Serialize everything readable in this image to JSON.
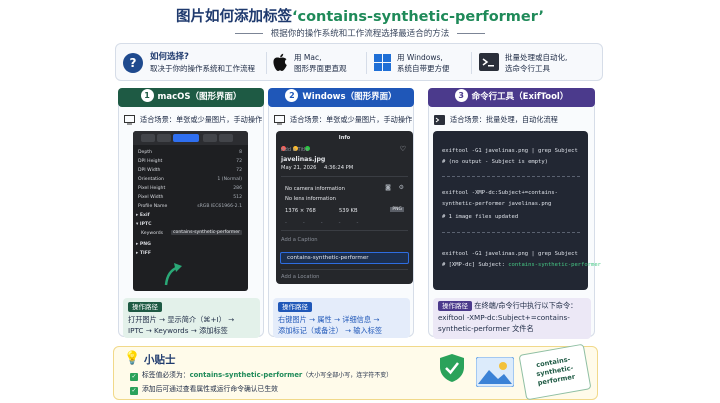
{
  "header": {
    "title_prefix": "图片如何添加标签",
    "title_keyword": "‘contains-synthetic-performer’",
    "subtitle": "根据你的操作系统和工作流程选择最适合的方法"
  },
  "guide": {
    "q_icon": "?",
    "heading": "如何选择?",
    "desc": "取决于你的操作系统和工作流程",
    "items": [
      {
        "icon": "apple-icon",
        "line1": "用 Mac,",
        "line2": "图形界面更直观"
      },
      {
        "icon": "windows-icon",
        "line1": "用 Windows,",
        "line2": "系统自带更方便"
      },
      {
        "icon": "terminal-icon",
        "line1": "批量处理或自动化,",
        "line2": "选命令行工具"
      }
    ]
  },
  "methods": [
    {
      "num": "1",
      "title": "macOS（图形界面）",
      "color": "#1e5a44",
      "scene": "适合场景：单张或少量图片，手动操作",
      "path_tag": "操作路径",
      "path_line1": "打开图片 → 显示简介（⌘+I） →",
      "path_line2": "IPTC → Keywords → 添加标签"
    },
    {
      "num": "2",
      "title": "Windows（图形界面）",
      "color": "#1f57b8",
      "scene": "适合场景：单张或少量图片，手动操作",
      "path_tag": "操作路径",
      "path_line1": "右键图片 → 属性 → 详细信息 →",
      "path_line2": "添加标记（或备注） → 输入标签"
    },
    {
      "num": "3",
      "title": "命令行工具（ExifTool）",
      "color": "#4b3a8c",
      "scene": "适合场景：批量处理，自动化流程",
      "path_tag": "操作路径",
      "path_line1": "在终端/命令行中执行以下命令：",
      "path_line2": "exiftool -XMP-dc:Subject+=contains-",
      "path_line3": "synthetic-performer 文件名"
    }
  ],
  "mac_panel": {
    "rows": [
      {
        "k": "Depth",
        "v": "8"
      },
      {
        "k": "DPI Height",
        "v": "72"
      },
      {
        "k": "DPI Width",
        "v": "72"
      },
      {
        "k": "Orientation",
        "v": "1 (Normal)"
      },
      {
        "k": "Pixel Height",
        "v": "286"
      },
      {
        "k": "Pixel Width",
        "v": "512"
      },
      {
        "k": "Profile Name",
        "v": "sRGB IEC61966-2.1"
      }
    ],
    "sec_exif": "▸ Exif",
    "sec_iptc": "▾ IPTC",
    "keywords_label": "Keywords",
    "keywords_value": "contains-synthetic-performer",
    "sec_png": "▸ PNG",
    "sec_tiff": "▸ TIFF"
  },
  "win_panel": {
    "window_title": "Info",
    "add_title": "Add a Title",
    "filename": "javelinas.jpg",
    "date": "May 21, 2026",
    "time": "4:36:24 PM",
    "camera": "No camera information",
    "lens": "No lens information",
    "dimensions": "1376 × 768",
    "size": "539 KB",
    "format": "PNG",
    "caption_placeholder": "Add a Caption",
    "keyword": "contains-synthetic-performer",
    "location_placeholder": "Add a Location"
  },
  "terminal": {
    "cmd1": "exiftool -G1 javelinas.png | grep Subject",
    "out1": "# (no output - Subject is empty)",
    "cmd2a": "exiftool -XMP-dc:Subject+=contains-",
    "cmd2b": "synthetic-performer javelinas.png",
    "out2": "# 1 image files updated",
    "cmd3": "exiftool -G1 javelinas.png | grep Subject",
    "out3_prefix": "# [XMP-dc] Subject:",
    "out3_value": "contains-synthetic-performer"
  },
  "tips": {
    "title": "小贴士",
    "line1_prefix": "标签值必须为：",
    "line1_keyword": "contains-synthetic-performer",
    "line1_suffix": "（大小写全部小写，连字符不变）",
    "line2": "添加后可通过查看属性或运行命令确认已生效",
    "badge_text_1": "contains-",
    "badge_text_2": "synthetic-",
    "badge_text_3": "performer"
  },
  "colors": {
    "green": "#1e5a44",
    "blue": "#1f57b8",
    "purple": "#4b3a8c",
    "accent_green": "#1f8a59"
  }
}
